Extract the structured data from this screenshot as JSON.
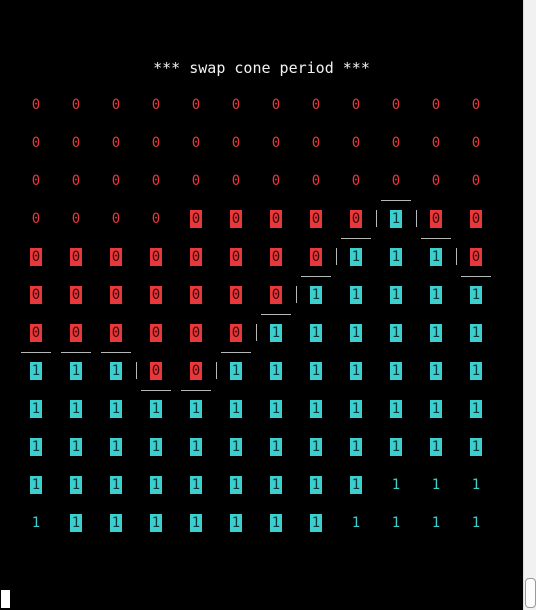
{
  "title": "*** swap cone period ***",
  "colors": {
    "zero": "#e8383b",
    "one": "#3ccfcf",
    "background": "#000000",
    "separator": "#b8b8b8"
  },
  "grid": {
    "rows": [
      [
        "0",
        "0",
        "0",
        "0",
        "0",
        "0",
        "0",
        "0",
        "0",
        "0",
        "0",
        "0"
      ],
      [
        "0",
        "0",
        "0",
        "0",
        "0",
        "0",
        "0",
        "0",
        "0",
        "0",
        "0",
        "0"
      ],
      [
        "0",
        "0",
        "0",
        "0",
        "0",
        "0",
        "0",
        "0",
        "0",
        "0",
        "0",
        "0"
      ],
      [
        "0",
        "0",
        "0",
        "0",
        "0",
        "0",
        "0",
        "0",
        "0",
        "1",
        "0",
        "0"
      ],
      [
        "0",
        "0",
        "0",
        "0",
        "0",
        "0",
        "0",
        "0",
        "1",
        "1",
        "1",
        "0"
      ],
      [
        "0",
        "0",
        "0",
        "0",
        "0",
        "0",
        "0",
        "1",
        "1",
        "1",
        "1",
        "1"
      ],
      [
        "0",
        "0",
        "0",
        "0",
        "0",
        "0",
        "1",
        "1",
        "1",
        "1",
        "1",
        "1"
      ],
      [
        "1",
        "1",
        "1",
        "0",
        "0",
        "1",
        "1",
        "1",
        "1",
        "1",
        "1",
        "1"
      ],
      [
        "1",
        "1",
        "1",
        "1",
        "1",
        "1",
        "1",
        "1",
        "1",
        "1",
        "1",
        "1"
      ],
      [
        "1",
        "1",
        "1",
        "1",
        "1",
        "1",
        "1",
        "1",
        "1",
        "1",
        "1",
        "1"
      ],
      [
        "1",
        "1",
        "1",
        "1",
        "1",
        "1",
        "1",
        "1",
        "1",
        "1",
        "1",
        "1"
      ],
      [
        "1",
        "1",
        "1",
        "1",
        "1",
        "1",
        "1",
        "1",
        "1",
        "1",
        "1",
        "1"
      ]
    ],
    "highlighted": [
      [
        0,
        0,
        0,
        0,
        0,
        0,
        0,
        0,
        0,
        0,
        0,
        0
      ],
      [
        0,
        0,
        0,
        0,
        0,
        0,
        0,
        0,
        0,
        0,
        0,
        0
      ],
      [
        0,
        0,
        0,
        0,
        0,
        0,
        0,
        0,
        0,
        0,
        0,
        0
      ],
      [
        0,
        0,
        0,
        0,
        1,
        1,
        1,
        1,
        1,
        1,
        1,
        1
      ],
      [
        1,
        1,
        1,
        1,
        1,
        1,
        1,
        1,
        1,
        1,
        1,
        1
      ],
      [
        1,
        1,
        1,
        1,
        1,
        1,
        1,
        1,
        1,
        1,
        1,
        1
      ],
      [
        1,
        1,
        1,
        1,
        1,
        1,
        1,
        1,
        1,
        1,
        1,
        1
      ],
      [
        1,
        1,
        1,
        1,
        1,
        1,
        1,
        1,
        1,
        1,
        1,
        1
      ],
      [
        1,
        1,
        1,
        1,
        1,
        1,
        1,
        1,
        1,
        1,
        1,
        1
      ],
      [
        1,
        1,
        1,
        1,
        1,
        1,
        1,
        1,
        1,
        1,
        1,
        1
      ],
      [
        1,
        1,
        1,
        1,
        1,
        1,
        1,
        1,
        1,
        0,
        0,
        0
      ],
      [
        0,
        1,
        1,
        1,
        1,
        1,
        1,
        1,
        0,
        0,
        0,
        0
      ]
    ]
  }
}
